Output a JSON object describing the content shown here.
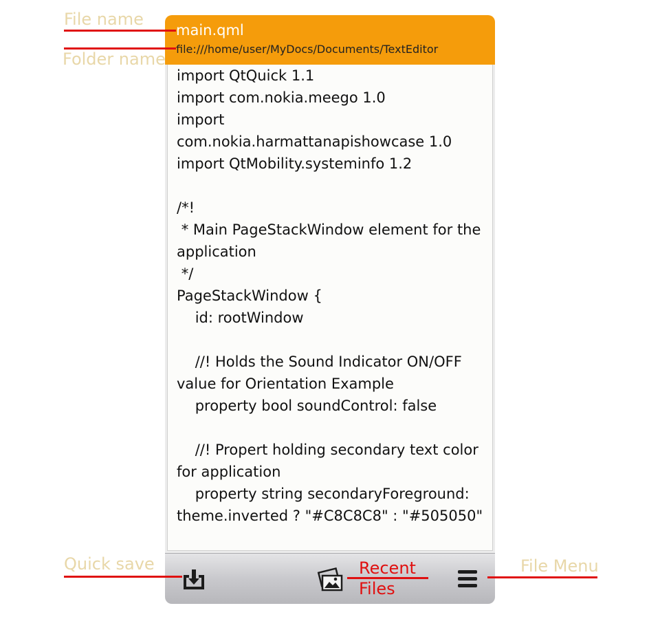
{
  "editor": {
    "file_name": "main.qml",
    "folder_path": "file:///home/user/MyDocs/Documents/TextEditor",
    "content": "import QtQuick 1.1\nimport com.nokia.meego 1.0\nimport\ncom.nokia.harmattanapishowcase 1.0\nimport QtMobility.systeminfo 1.2\n\n/*!\n * Main PageStackWindow element for the application\n */\nPageStackWindow {\n    id: rootWindow\n\n    //! Holds the Sound Indicator ON/OFF value for Orientation Example\n    property bool soundControl: false\n\n    //! Propert holding secondary text color for application\n    property string secondaryForeground: theme.inverted ? \"#C8C8C8\" : \"#505050\""
  },
  "toolbar": {
    "quick_save_icon": "save-download-icon",
    "recent_files_icon": "gallery-icon",
    "file_menu_icon": "menu-icon"
  },
  "annotations": {
    "file_name": "File name",
    "folder_name": "Folder name",
    "quick_save": "Quick save",
    "recent_files_line1": "Recent",
    "recent_files_line2": "Files",
    "file_menu": "File Menu"
  },
  "colors": {
    "header": "#f59c0b",
    "annotation_text": "#e8d7a8",
    "annotation_text_red": "#e01010",
    "annotation_line": "#e01010"
  }
}
